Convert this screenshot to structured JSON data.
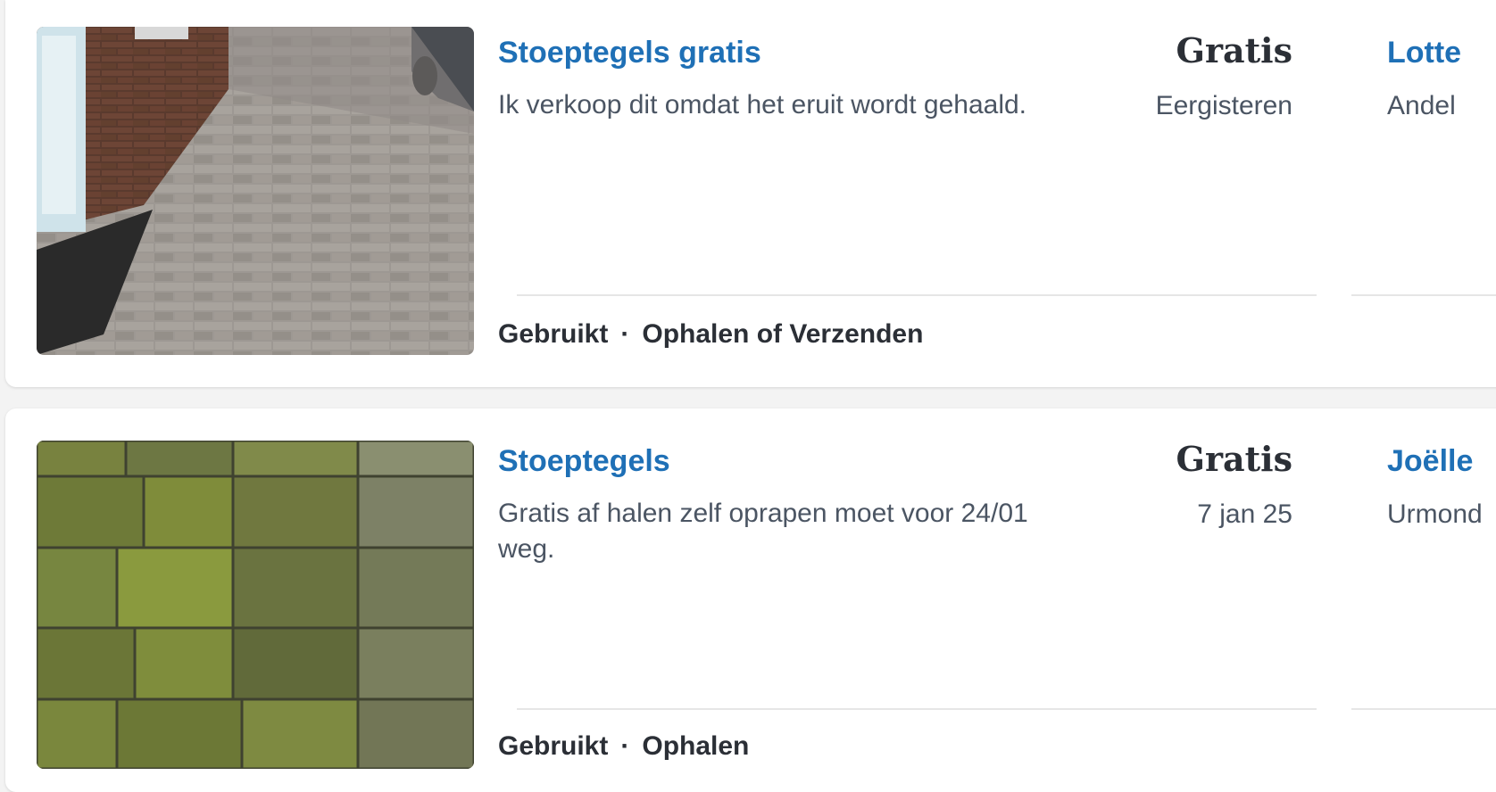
{
  "listings": [
    {
      "title": "Stoeptegels gratis",
      "description": "Ik verkoop dit omdat het eruit wordt gehaald.",
      "price": "Gratis",
      "posted": "Eergisteren",
      "seller": "Lotte",
      "location": "Andel",
      "condition": "Gebruikt",
      "separator": "·",
      "delivery": "Ophalen of Verzenden",
      "image": "paving-driveway-photo"
    },
    {
      "title": "Stoeptegels",
      "description": "Gratis af halen zelf oprapen moet voor 24/01 weg.",
      "price": "Gratis",
      "posted": "7 jan 25",
      "seller": "Joëlle",
      "location": "Urmond",
      "condition": "Gebruikt",
      "separator": "·",
      "delivery": "Ophalen",
      "image": "mossy-tiles-photo"
    }
  ],
  "colors": {
    "link": "#1f70b6",
    "text": "#2b2f36",
    "muted": "#4b5563",
    "card": "#ffffff",
    "background": "#f3f3f3"
  }
}
